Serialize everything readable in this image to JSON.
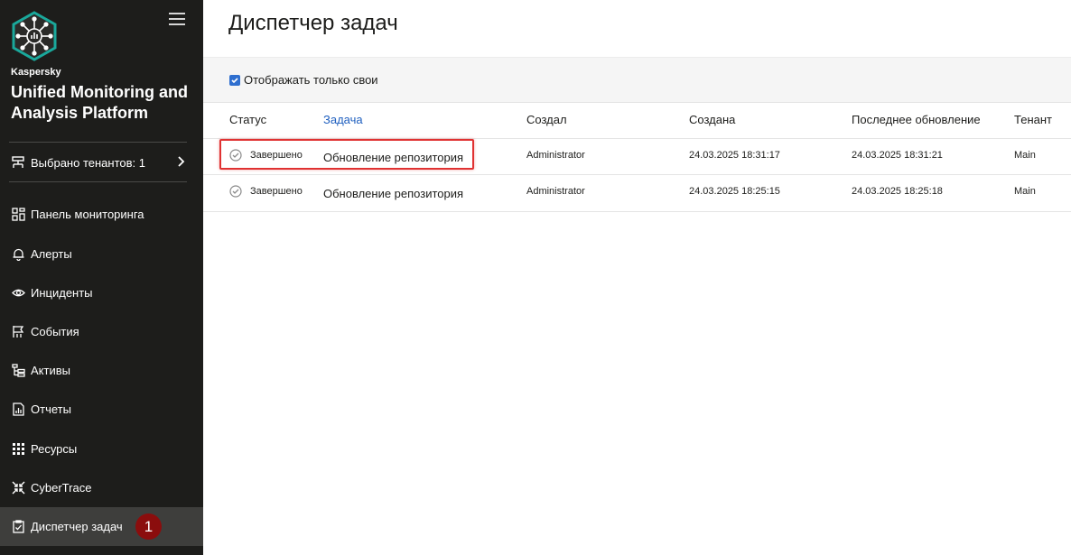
{
  "sidebar": {
    "brand": "Kaspersky",
    "product": "Unified Monitoring and Analysis Platform",
    "tenant_label": "Выбрано тенантов: 1",
    "items": [
      {
        "label": "Панель мониторинга",
        "icon": "dashboard-icon"
      },
      {
        "label": "Алерты",
        "icon": "bell-icon"
      },
      {
        "label": "Инциденты",
        "icon": "eye-icon"
      },
      {
        "label": "События",
        "icon": "flag-icon"
      },
      {
        "label": "Активы",
        "icon": "assets-tree-icon"
      },
      {
        "label": "Отчеты",
        "icon": "report-chart-icon"
      },
      {
        "label": "Ресурсы",
        "icon": "grid-dots-icon"
      },
      {
        "label": "CyberTrace",
        "icon": "arrows-in-icon"
      },
      {
        "label": "Диспетчер задач",
        "icon": "clipboard-check-icon",
        "active": true,
        "badge": "1"
      }
    ]
  },
  "main": {
    "title": "Диспетчер задач",
    "filter": {
      "label": "Отображать только свои",
      "checked": true
    },
    "columns": [
      "Статус",
      "Задача",
      "Создал",
      "Создана",
      "Последнее обновление",
      "Тенант"
    ],
    "rows": [
      {
        "status": "Завершено",
        "task": "Обновление репозитория",
        "created_by": "Administrator",
        "created": "24.03.2025 18:31:17",
        "updated": "24.03.2025 18:31:21",
        "tenant": "Main"
      },
      {
        "status": "Завершено",
        "task": "Обновление репозитория",
        "created_by": "Administrator",
        "created": "24.03.2025 18:25:15",
        "updated": "24.03.2025 18:25:18",
        "tenant": "Main"
      }
    ]
  },
  "colors": {
    "sidebar_bg": "#1d1d1b",
    "accent_teal": "#1aa89b",
    "link_blue": "#1f5fbf",
    "highlight_red": "#e03232",
    "badge_red": "#8b0d0d"
  }
}
